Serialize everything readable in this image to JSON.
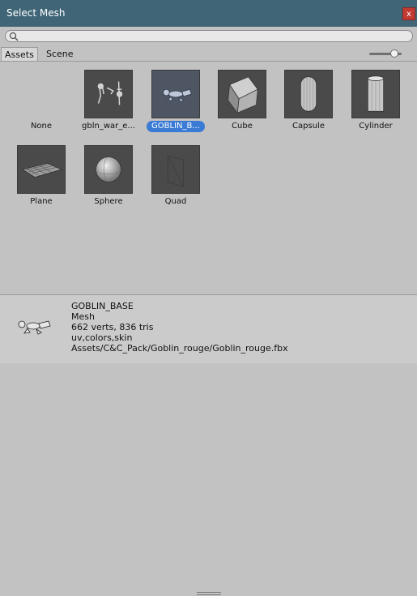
{
  "window": {
    "title": "Select Mesh",
    "close_label": "x"
  },
  "search": {
    "placeholder": ""
  },
  "tabs": [
    {
      "label": "Assets",
      "active": true
    },
    {
      "label": "Scene",
      "active": false
    }
  ],
  "zoom_slider": {
    "value": 0.8
  },
  "items": [
    {
      "label": "None",
      "icon": "none",
      "selected": false
    },
    {
      "label": "gbln_war_e...",
      "icon": "goblin-war-mesh",
      "selected": false
    },
    {
      "label": "GOBLIN_B...",
      "icon": "goblin-base-mesh",
      "selected": true
    },
    {
      "label": "Cube",
      "icon": "cube-mesh",
      "selected": false
    },
    {
      "label": "Capsule",
      "icon": "capsule-mesh",
      "selected": false
    },
    {
      "label": "Cylinder",
      "icon": "cylinder-mesh",
      "selected": false
    },
    {
      "label": "Plane",
      "icon": "plane-mesh",
      "selected": false
    },
    {
      "label": "Sphere",
      "icon": "sphere-mesh",
      "selected": false
    },
    {
      "label": "Quad",
      "icon": "quad-mesh",
      "selected": false
    }
  ],
  "preview": {
    "name": "GOBLIN_BASE",
    "type": "Mesh",
    "stats": "662 verts, 836 tris",
    "channels": "uv,colors,skin",
    "path": "Assets/C&C_Pack/Goblin_rouge/Goblin_rouge.fbx"
  },
  "colors": {
    "titlebar": "#3f6577",
    "selection": "#3a7bd5",
    "close": "#c23a32"
  }
}
